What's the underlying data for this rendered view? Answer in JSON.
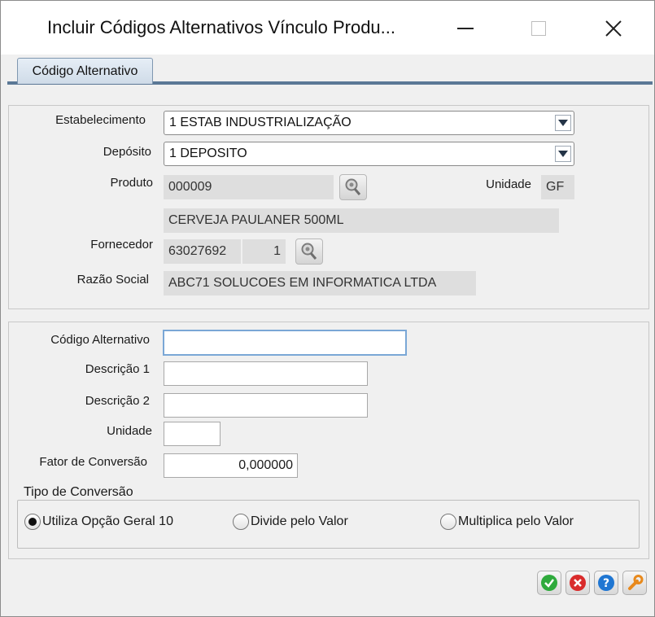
{
  "window": {
    "title": "Incluir Códigos Alternativos Vínculo Produ..."
  },
  "tabs": [
    {
      "label": "Código Alternativo"
    }
  ],
  "header_panel": {
    "estabelecimento": {
      "label": "Estabelecimento",
      "value": "1 ESTAB INDUSTRIALIZAÇÃO"
    },
    "deposito": {
      "label": "Depósito",
      "value": "1 DEPOSITO"
    },
    "produto": {
      "label": "Produto",
      "code": "000009",
      "description": "CERVEJA PAULANER 500ML"
    },
    "unidade": {
      "label": "Unidade",
      "value": "GF"
    },
    "fornecedor": {
      "label": "Fornecedor",
      "code": "63027692",
      "seq": "1"
    },
    "razao_social": {
      "label": "Razão Social",
      "value": "ABC71 SOLUCOES EM INFORMATICA LTDA"
    }
  },
  "form": {
    "codigo_alternativo": {
      "label": "Código Alternativo",
      "value": ""
    },
    "descricao1": {
      "label": "Descrição 1",
      "value": ""
    },
    "descricao2": {
      "label": "Descrição 2",
      "value": ""
    },
    "unidade": {
      "label": "Unidade",
      "value": ""
    },
    "fator_conversao": {
      "label": "Fator de Conversão",
      "value": "0,000000"
    }
  },
  "tipo_conversao": {
    "title": "Tipo de Conversão",
    "options": [
      {
        "label": "Utiliza Opção Geral 10",
        "selected": true
      },
      {
        "label": "Divide pelo Valor",
        "selected": false
      },
      {
        "label": "Multiplica pelo Valor",
        "selected": false
      }
    ]
  },
  "icons": {
    "confirm": "check-icon",
    "cancel": "close-icon",
    "help": "help-icon",
    "settings": "wrench-icon",
    "lookup": "search-icon"
  },
  "colors": {
    "confirm": "#2eaa3c",
    "cancel": "#d92b2b",
    "help": "#1f76d2",
    "settings": "#e8891c",
    "tab_accent": "#5b7896"
  }
}
